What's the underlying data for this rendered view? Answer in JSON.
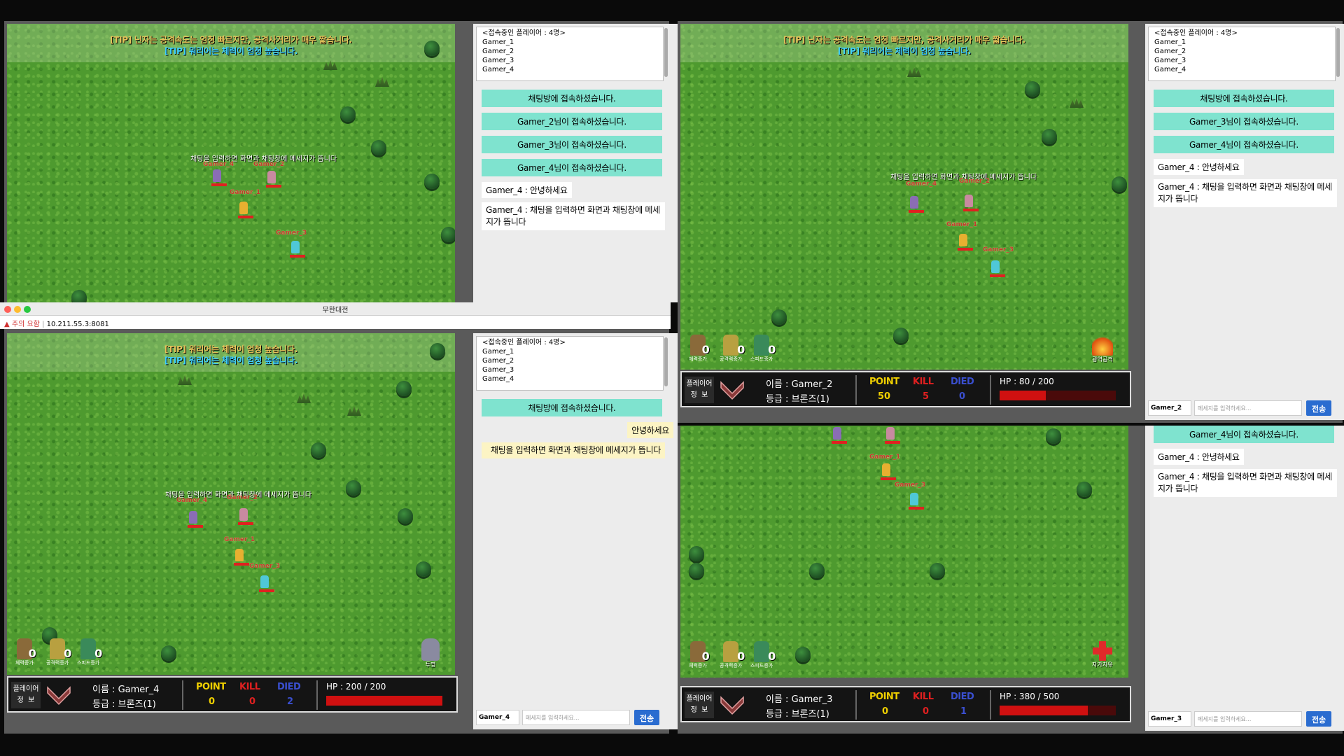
{
  "tips": {
    "tip1": "[TIP] 닌자는 공격속도는 엄청 빠르지만, 공격사거리가 매우 짧습니다.",
    "tip2": "[TIP] 워리어는 체력이 엄청 높습니다."
  },
  "overlay_message": "채팅을 입력하면 화면과 채팅창에 메세지가 뜹니다",
  "players_header": "<접속중인 플레이어 : 4명>",
  "players": [
    "Gamer_1",
    "Gamer_2",
    "Gamer_3",
    "Gamer_4"
  ],
  "names": {
    "g1": "Gamer_1",
    "g2": "Gamer_2",
    "g3": "Gamer_3",
    "g4": "Gamer_4"
  },
  "system_msgs": {
    "joined": "채팅방에 접속하셨습니다.",
    "g2": "Gamer_2님이 접속하셨습니다.",
    "g3": "Gamer_3님이 접속하셨습니다.",
    "g4": "Gamer_4님이 접속하셨습니다."
  },
  "user_msgs": {
    "hello": "Gamer_4 : 안녕하세요",
    "long": "Gamer_4 : 채팅을 입력하면 화면과 채팅창에 메세지가 뜹니다"
  },
  "own_msgs": {
    "hello": "안녕하세요",
    "long": "채팅을 입력하면 화면과 채팅창에 메세지가 뜹니다"
  },
  "hud": {
    "hp_up": "체력증가",
    "atk_up": "공격력증가",
    "spd_up": "스피드증가",
    "count": "0"
  },
  "skills": {
    "area": "광역공격",
    "heal": "자가치유",
    "stealth": "투명"
  },
  "status_labels": {
    "info": "플레이어\n정  보",
    "point": "POINT",
    "kill": "KILL",
    "died": "DIED"
  },
  "chat_ui": {
    "placeholder": "메세지를 입력하세요...",
    "send": "전송"
  },
  "browser": {
    "title": "무한대전",
    "warning": "주의 요함",
    "url": "10.211.55.3:8081"
  },
  "panels": {
    "tr": {
      "name": "이름 : Gamer_2",
      "grade": "등급 : 브론즈(1)",
      "point": "50",
      "kill": "5",
      "died": "0",
      "hp": "HP : 80 / 200",
      "hp_ratio": 0.4,
      "user": "Gamer_2"
    },
    "bl": {
      "name": "이름 : Gamer_4",
      "grade": "등급 : 브론즈(1)",
      "point": "0",
      "kill": "0",
      "died": "2",
      "hp": "HP : 200 / 200",
      "hp_ratio": 1.0,
      "user": "Gamer_4"
    },
    "br": {
      "name": "이름 : Gamer_3",
      "grade": "등급 : 브론즈(1)",
      "point": "0",
      "kill": "0",
      "died": "1",
      "hp": "HP : 380 / 500",
      "hp_ratio": 0.76,
      "user": "Gamer_3"
    }
  },
  "colors": {
    "grass": "#4e9a2f",
    "system_msg": "#7fe3cf",
    "own_msg": "#fcf4c4",
    "send_btn": "#2a6cd0",
    "point": "#f0d000",
    "kill": "#e02020",
    "died": "#3a4fd0"
  }
}
